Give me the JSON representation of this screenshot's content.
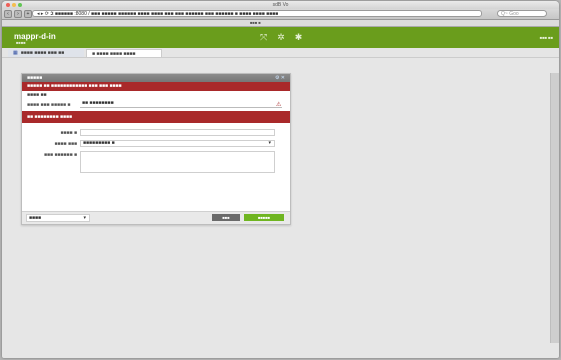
{
  "browser": {
    "title": "sdB Vo",
    "url": "◂ ▸  ⟳  𝕴 ■■■■■■ :8080 / ■■■ ■■■■■ ■■■■■■ ■■■■ ■■■■ ■■■ ■■■ ■■■■■■ ■■■ ■■■■■■ ■ ■■■■ ■■■■ ■■■■",
    "search_placeholder": "Q~ Goo",
    "bookmark": "■■■ ■"
  },
  "app": {
    "logo": "mappr-d-in",
    "logo_sub": "■■■■",
    "header_right": "■■■ ■■",
    "tabs": [
      {
        "label": "■■■■ ■■■■ ■■■ ■■"
      },
      {
        "label": "■ ■■■■ ■■■■ ■■■■"
      }
    ]
  },
  "panel": {
    "title": "■■■■■",
    "alert": "■■■■■ ■■ ■■■■■■■■■■■■ ■■■ ■■■ ■■■■",
    "subtext": "■■■■ ■■",
    "code_label": "■■■■ ■■■ ■■■■■ ■",
    "code_value": "■■ ■■■■■■■■",
    "section_title": "■■ ■■■■■■■■ ■■■■",
    "fields": [
      {
        "label": "■■■■ ■",
        "value": ""
      },
      {
        "label": "■■■■ ■■■",
        "value": "■■■■■■■■■ ■"
      },
      {
        "label": "■■■ ■■■■■■ ■",
        "value": ""
      }
    ],
    "footer_select": "■■■■",
    "cancel_label": "■■■",
    "save_label": "■■■■■"
  },
  "colors": {
    "header_green": "#6a9d1c",
    "alert_red": "#a9292a",
    "save_green": "#6fb521"
  }
}
